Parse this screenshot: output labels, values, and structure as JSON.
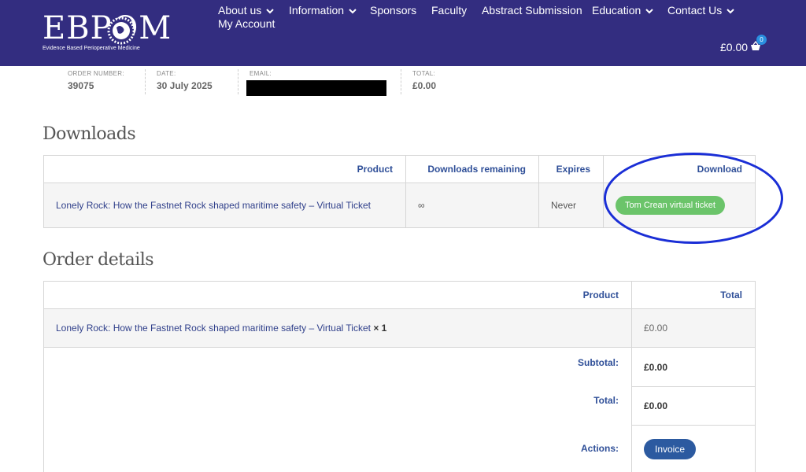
{
  "header": {
    "logo_text": "EBPOM",
    "logo_subtitle": "Evidence Based Perioperative Medicine",
    "brand_color": "#332d80",
    "nav": [
      {
        "label": "About us",
        "has_dropdown": true
      },
      {
        "label": "Information",
        "has_dropdown": true
      },
      {
        "label": "Sponsors",
        "has_dropdown": false
      },
      {
        "label": "Faculty",
        "has_dropdown": false
      },
      {
        "label": "Abstract Submission",
        "has_dropdown": false
      },
      {
        "label": "Education",
        "has_dropdown": true
      },
      {
        "label": "Contact Us",
        "has_dropdown": true
      },
      {
        "label": "My Account",
        "has_dropdown": false
      }
    ],
    "cart": {
      "total": "£0.00",
      "count": "0",
      "icon": "basket-icon"
    }
  },
  "overview": {
    "order_number_label": "ORDER NUMBER:",
    "order_number": "39075",
    "date_label": "DATE:",
    "date": "30 July 2025",
    "email_label": "EMAIL:",
    "total_label": "TOTAL:",
    "total": "£0.00"
  },
  "downloads": {
    "title": "Downloads",
    "headers": {
      "product": "Product",
      "remaining": "Downloads remaining",
      "expires": "Expires",
      "download": "Download"
    },
    "row": {
      "product": "Lonely Rock: How the Fastnet Rock shaped maritime safety – Virtual Ticket",
      "remaining": "∞",
      "expires": "Never",
      "download_button": "Tom Crean virtual ticket"
    }
  },
  "order_details": {
    "title": "Order details",
    "headers": {
      "product": "Product",
      "total": "Total"
    },
    "item": {
      "product": "Lonely Rock: How the Fastnet Rock shaped maritime safety – Virtual Ticket",
      "qty": "× 1",
      "total": "£0.00"
    },
    "subtotal_label": "Subtotal:",
    "subtotal": "£0.00",
    "total_label": "Total:",
    "total": "£0.00",
    "actions_label": "Actions:",
    "invoice_button": "Invoice"
  }
}
